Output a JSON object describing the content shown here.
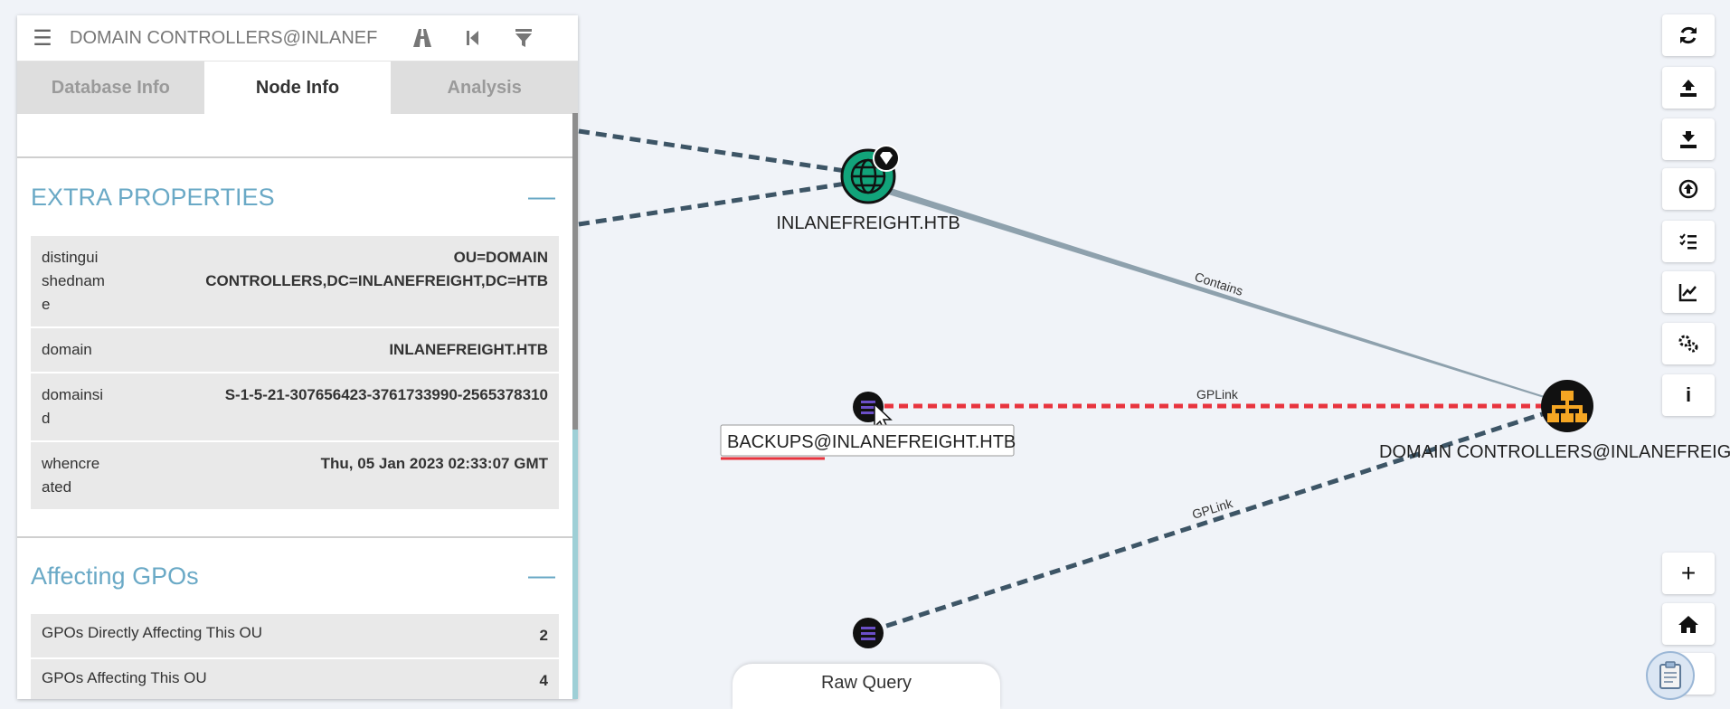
{
  "header": {
    "search_value": "DOMAIN CONTROLLERS@INLANEF",
    "menu_icon": "hamburger-menu-icon",
    "icons": [
      "pathfinding-icon",
      "back-icon",
      "filter-icon"
    ]
  },
  "tabs": [
    {
      "label": "Database Info"
    },
    {
      "label": "Node Info"
    },
    {
      "label": "Analysis"
    }
  ],
  "extra_properties": {
    "title": "EXTRA PROPERTIES",
    "rows": [
      {
        "key": "distinguishedname",
        "value": "OU=DOMAIN CONTROLLERS,DC=INLANEFREIGHT,DC=HTB"
      },
      {
        "key": "domain",
        "value": "INLANEFREIGHT.HTB"
      },
      {
        "key": "domainsid",
        "value": "S-1-5-21-307656423-3761733990-2565378310"
      },
      {
        "key": "whencreated",
        "value": "Thu, 05 Jan 2023 02:33:07 GMT"
      }
    ]
  },
  "affecting_gpos": {
    "title": "Affecting GPOs",
    "rows": [
      {
        "key": "GPOs Directly Affecting This OU",
        "value": "2"
      },
      {
        "key": "GPOs Affecting This OU",
        "value": "4"
      }
    ]
  },
  "graph": {
    "domain_node_label": "INLANEFREIGHT.HTB",
    "gpo_node_label": "BACKUPS@INLANEFREIGHT.HTB",
    "ou_node_label": "DOMAIN CONTROLLERS@INLANEFREIGHT",
    "edge_contains": "Contains",
    "edge_gplink_1": "GPLink",
    "edge_gplink_2": "GPLink"
  },
  "toolbar": {
    "icons": [
      "refresh-icon",
      "upload-icon",
      "download-icon",
      "import-icon",
      "query-list-icon",
      "stats-icon",
      "settings-icon",
      "info-icon",
      "zoom-in-icon",
      "home-icon",
      "zoom-out-icon"
    ],
    "info_label": "i",
    "zoom_in_label": "+"
  },
  "raw_query_label": "Raw Query",
  "colors": {
    "accent": "#6aa9c6",
    "highlight_edge": "#e8343e",
    "edge_dark": "#3d5566",
    "domain_node": "#12a37a",
    "ou_node": "#f5a623",
    "gpo_node": "#6b4fc8"
  }
}
